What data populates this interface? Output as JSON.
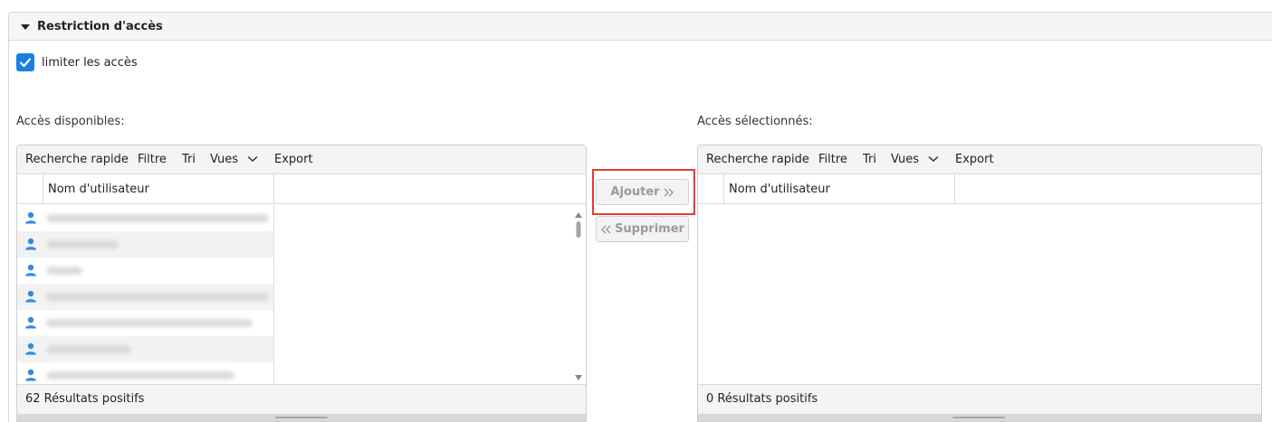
{
  "panel": {
    "title": "Restriction d'accès"
  },
  "checkbox": {
    "label": "limiter les accès",
    "checked": true
  },
  "available": {
    "label": "Accès disponibles:",
    "toolbar": {
      "quick_search": "Recherche rapide",
      "filter": "Filtre",
      "sort": "Tri",
      "views": "Vues",
      "export": "Export"
    },
    "column": "Nom d'utilisateur",
    "footer": "62 Résultats positifs"
  },
  "selected": {
    "label": "Accès sélectionnés:",
    "toolbar": {
      "quick_search": "Recherche rapide",
      "filter": "Filtre",
      "sort": "Tri",
      "views": "Vues",
      "export": "Export"
    },
    "column": "Nom d'utilisateur",
    "footer": "0 Résultats positifs"
  },
  "buttons": {
    "add": "Ajouter",
    "remove": "Supprimer"
  },
  "colors": {
    "accent": "#1a7fe0",
    "highlight": "#e53935",
    "user_icon": "#2f8ce6"
  },
  "icons": {
    "caret": "caret-down-icon",
    "check": "check-icon",
    "user": "user-icon",
    "views": "chevron-down-icon",
    "add": "double-chevron-right-icon",
    "remove": "double-chevron-left-icon"
  }
}
